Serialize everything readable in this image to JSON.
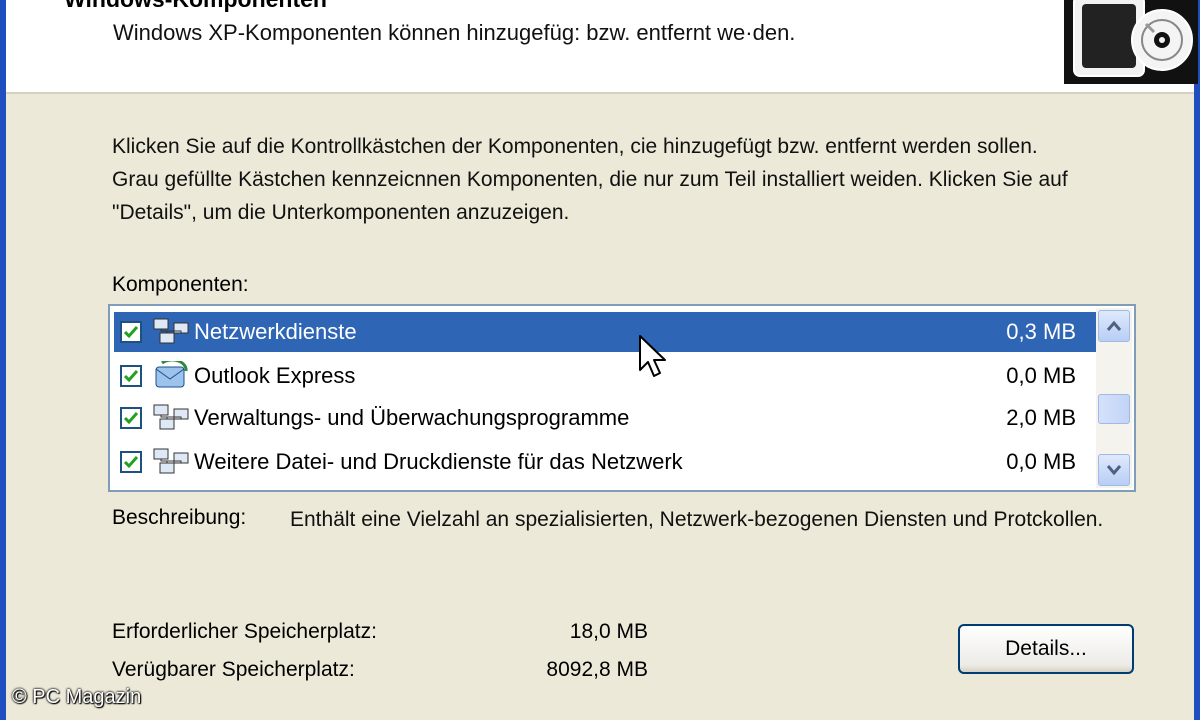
{
  "header": {
    "title": "Windows-Komponenten",
    "subtitle": "Windows XP-Komponenten können hinzugefüg: bzw. entfernt we·den."
  },
  "intro_text": "Klicken Sie auf die Kontrollkästchen der Komponenten, cie hinzugefügt bzw. entfernt werden sollen. Grau gefüllte Kästchen kennzeicnnen Komponenten, die nur zum Teil installiert weiden. Klicken Sie auf \"Details\", um die Unterkomponenten anzuzeigen.",
  "components_label": "Komponenten:",
  "components": [
    {
      "name": "Netzwerkdienste",
      "size": "0,3 MB",
      "checked": true,
      "selected": true,
      "icon": "network-icon"
    },
    {
      "name": "Outlook Express",
      "size": "0,0 MB",
      "checked": true,
      "selected": false,
      "icon": "outlook-express-icon"
    },
    {
      "name": "Verwaltungs- und Überwachungsprogramme",
      "size": "2,0 MB",
      "checked": true,
      "selected": false,
      "icon": "network-icon"
    },
    {
      "name": "Weitere Datei- und Druckdienste für das Netzwerk",
      "size": "0,0 MB",
      "checked": true,
      "selected": false,
      "icon": "network-icon"
    }
  ],
  "description": {
    "label": "Beschreibung:",
    "text": "Enthält eine Vielzahl an spezialisierten, Netzwerk-bezogenen Diensten und Protckollen."
  },
  "required_space": {
    "label": "Erforderlicher Speicherplatz:",
    "value": "18,0 MB"
  },
  "available_space": {
    "label": "Verügbarer Speicherplatz:",
    "value": "8092,8 MB"
  },
  "details_button": "Details...",
  "watermark": "© PC Magazin",
  "colors": {
    "selection": "#2f65b5",
    "frame": "#1f4fbf",
    "dialog_bg": "#ece9d8"
  }
}
